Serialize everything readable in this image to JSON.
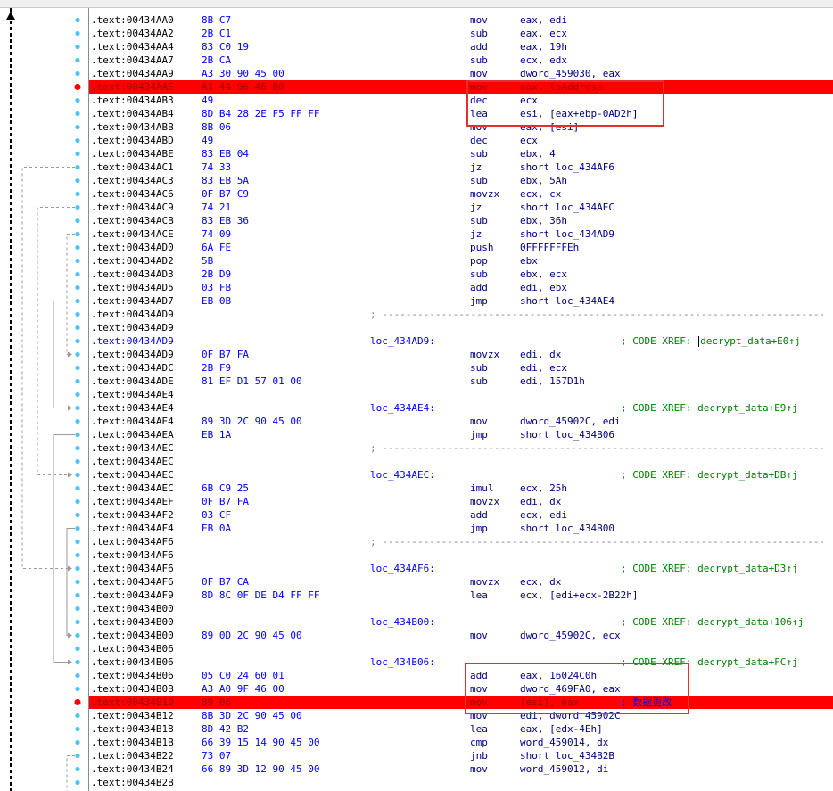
{
  "colors": {
    "breakpoint_bg": "#ff0000",
    "annotation_box": "#e03030",
    "dot": "#4fc3f7",
    "bp_dot": "#ff0000"
  },
  "rows": [
    {
      "addr": ".text:00434AA0",
      "bytes": "8B C7",
      "mn": "mov",
      "op": "eax, edi"
    },
    {
      "addr": ".text:00434AA2",
      "bytes": "2B C1",
      "mn": "sub",
      "op": "eax, ecx"
    },
    {
      "addr": ".text:00434AA4",
      "bytes": "83 C0 19",
      "mn": "add",
      "op": "eax, 19h"
    },
    {
      "addr": ".text:00434AA7",
      "bytes": "2B CA",
      "mn": "sub",
      "op": "ecx, edx"
    },
    {
      "addr": ".text:00434AA9",
      "bytes": "A3 30 90 45 00",
      "mn": "mov",
      "op": "dword_459030, eax"
    },
    {
      "addr": ".text:00434AAE",
      "bytes": "A1 44 96 46 00",
      "mn": "mov",
      "op": "eax, lpAddress",
      "bp": true
    },
    {
      "addr": ".text:00434AB3",
      "bytes": "49",
      "mn": "dec",
      "op": "ecx"
    },
    {
      "addr": ".text:00434AB4",
      "bytes": "8D B4 28 2E F5 FF FF",
      "mn": "lea",
      "op": "esi, [eax+ebp-0AD2h]"
    },
    {
      "addr": ".text:00434ABB",
      "bytes": "8B 06",
      "mn": "mov",
      "op": "eax, [esi]"
    },
    {
      "addr": ".text:00434ABD",
      "bytes": "49",
      "mn": "dec",
      "op": "ecx"
    },
    {
      "addr": ".text:00434ABE",
      "bytes": "83 EB 04",
      "mn": "sub",
      "op": "ebx, 4"
    },
    {
      "addr": ".text:00434AC1",
      "bytes": "74 33",
      "mn": "jz",
      "op": "short loc_434AF6"
    },
    {
      "addr": ".text:00434AC3",
      "bytes": "83 EB 5A",
      "mn": "sub",
      "op": "ebx, 5Ah"
    },
    {
      "addr": ".text:00434AC6",
      "bytes": "0F B7 C9",
      "mn": "movzx",
      "op": "ecx, cx"
    },
    {
      "addr": ".text:00434AC9",
      "bytes": "74 21",
      "mn": "jz",
      "op": "short loc_434AEC"
    },
    {
      "addr": ".text:00434ACB",
      "bytes": "83 EB 36",
      "mn": "sub",
      "op": "ebx, 36h"
    },
    {
      "addr": ".text:00434ACE",
      "bytes": "74 09",
      "mn": "jz",
      "op": "short loc_434AD9"
    },
    {
      "addr": ".text:00434AD0",
      "bytes": "6A FE",
      "mn": "push",
      "op": "0FFFFFFFEh"
    },
    {
      "addr": ".text:00434AD2",
      "bytes": "5B",
      "mn": "pop",
      "op": "ebx"
    },
    {
      "addr": ".text:00434AD3",
      "bytes": "2B D9",
      "mn": "sub",
      "op": "ebx, ecx"
    },
    {
      "addr": ".text:00434AD5",
      "bytes": "03 FB",
      "mn": "add",
      "op": "edi, ebx"
    },
    {
      "addr": ".text:00434AD7",
      "bytes": "EB 0B",
      "mn": "jmp",
      "op": "short loc_434AE4"
    },
    {
      "addr": ".text:00434AD9",
      "sep": "; ---------------------------------------------------------------------------"
    },
    {
      "addr": ".text:00434AD9"
    },
    {
      "addr": ".text:00434AD9",
      "label": "loc_434AD9:",
      "comment": "; CODE XREF: ",
      "xref": "decrypt_data+E0↑j",
      "caret": true,
      "hl": true
    },
    {
      "addr": ".text:00434AD9",
      "bytes": "0F B7 FA",
      "mn": "movzx",
      "op": "edi, dx"
    },
    {
      "addr": ".text:00434ADC",
      "bytes": "2B F9",
      "mn": "sub",
      "op": "edi, ecx"
    },
    {
      "addr": ".text:00434ADE",
      "bytes": "81 EF D1 57 01 00",
      "mn": "sub",
      "op": "edi, 157D1h"
    },
    {
      "addr": ".text:00434AE4"
    },
    {
      "addr": ".text:00434AE4",
      "label": "loc_434AE4:",
      "comment": "; CODE XREF: decrypt_data+E9↑j"
    },
    {
      "addr": ".text:00434AE4",
      "bytes": "89 3D 2C 90 45 00",
      "mn": "mov",
      "op": "dword_45902C, edi"
    },
    {
      "addr": ".text:00434AEA",
      "bytes": "EB 1A",
      "mn": "jmp",
      "op": "short loc_434B06"
    },
    {
      "addr": ".text:00434AEC",
      "sep": "; ---------------------------------------------------------------------------"
    },
    {
      "addr": ".text:00434AEC"
    },
    {
      "addr": ".text:00434AEC",
      "label": "loc_434AEC:",
      "comment": "; CODE XREF: decrypt_data+DB↑j"
    },
    {
      "addr": ".text:00434AEC",
      "bytes": "6B C9 25",
      "mn": "imul",
      "op": "ecx, 25h"
    },
    {
      "addr": ".text:00434AEF",
      "bytes": "0F B7 FA",
      "mn": "movzx",
      "op": "edi, dx"
    },
    {
      "addr": ".text:00434AF2",
      "bytes": "03 CF",
      "mn": "add",
      "op": "ecx, edi"
    },
    {
      "addr": ".text:00434AF4",
      "bytes": "EB 0A",
      "mn": "jmp",
      "op": "short loc_434B00"
    },
    {
      "addr": ".text:00434AF6",
      "sep": "; ---------------------------------------------------------------------------"
    },
    {
      "addr": ".text:00434AF6"
    },
    {
      "addr": ".text:00434AF6",
      "label": "loc_434AF6:",
      "comment": "; CODE XREF: decrypt_data+D3↑j"
    },
    {
      "addr": ".text:00434AF6",
      "bytes": "0F B7 CA",
      "mn": "movzx",
      "op": "ecx, dx"
    },
    {
      "addr": ".text:00434AF9",
      "bytes": "8D 8C 0F DE D4 FF FF",
      "mn": "lea",
      "op": "ecx, [edi+ecx-2B22h]"
    },
    {
      "addr": ".text:00434B00"
    },
    {
      "addr": ".text:00434B00",
      "label": "loc_434B00:",
      "comment": "; CODE XREF: decrypt_data+106↑j"
    },
    {
      "addr": ".text:00434B00",
      "bytes": "89 0D 2C 90 45 00",
      "mn": "mov",
      "op": "dword_45902C, ecx"
    },
    {
      "addr": ".text:00434B06"
    },
    {
      "addr": ".text:00434B06",
      "label": "loc_434B06:",
      "comment": "; CODE XREF: decrypt_data+FC↑j"
    },
    {
      "addr": ".text:00434B06",
      "bytes": "05 C0 24 60 01",
      "mn": "add",
      "op": "eax, 16024C0h"
    },
    {
      "addr": ".text:00434B0B",
      "bytes": "A3 A0 9F 46 00",
      "mn": "mov",
      "op": "dword_469FA0, eax"
    },
    {
      "addr": ".text:00434B10",
      "bytes": "89 06",
      "mn": "mov",
      "op": "[esi], eax",
      "comment": "; 数据更改",
      "bp": true
    },
    {
      "addr": ".text:00434B12",
      "bytes": "8B 3D 2C 90 45 00",
      "mn": "mov",
      "op": "edi, dword_45902C"
    },
    {
      "addr": ".text:00434B18",
      "bytes": "8D 42 B2",
      "mn": "lea",
      "op": "eax, [edx-4Eh]"
    },
    {
      "addr": ".text:00434B1B",
      "bytes": "66 39 15 14 90 45 00",
      "mn": "cmp",
      "op": "word_459014, dx"
    },
    {
      "addr": ".text:00434B22",
      "bytes": "73 07",
      "mn": "jnb",
      "op": "short loc_434B2B"
    },
    {
      "addr": ".text:00434B24",
      "bytes": "66 89 3D 12 90 45 00",
      "mn": "mov",
      "op": "word_459012, di"
    },
    {
      "addr": ".text:00434B2B"
    }
  ]
}
